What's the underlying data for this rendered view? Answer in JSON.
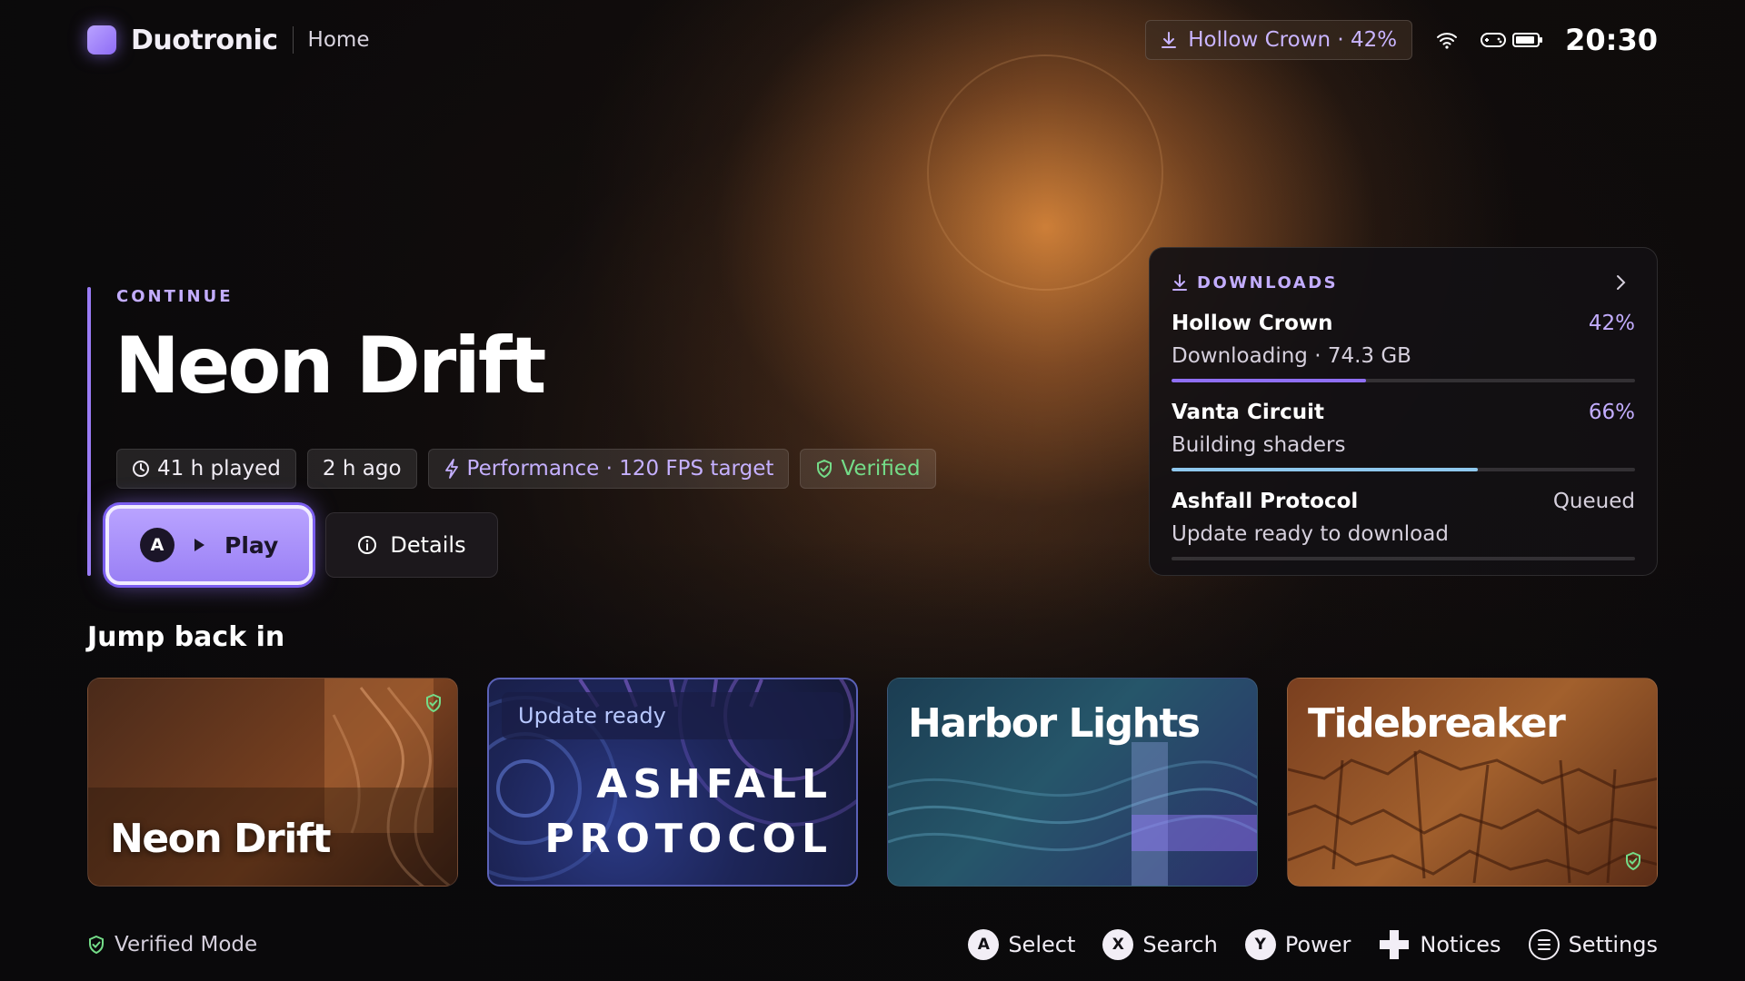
{
  "topbar": {
    "brand": "Duotronic",
    "crumb": "Home",
    "download_pill": "Hollow Crown · 42%",
    "clock": "20:30",
    "icons": [
      "download-icon",
      "wifi-icon",
      "gamepad-icon",
      "battery-icon"
    ]
  },
  "hero": {
    "eyebrow": "CONTINUE",
    "title": "Neon Drift",
    "chips": {
      "played": "41 h played",
      "ago": "2 h ago",
      "performance": "Performance · 120 FPS target",
      "verified": "Verified"
    },
    "play_key": "A",
    "play_label": "Play",
    "details_label": "Details"
  },
  "downloads": {
    "title": "DOWNLOADS",
    "items": [
      {
        "name": "Hollow Crown",
        "status": "42%",
        "detail": "Downloading · 74.3 GB",
        "progress": 0.42,
        "color": "#8f6ff5"
      },
      {
        "name": "Vanta Circuit",
        "status": "66%",
        "detail": "Building shaders",
        "progress": 0.66,
        "color": "#8fc8ee"
      },
      {
        "name": "Ashfall Protocol",
        "status": "Queued",
        "detail": "Update ready to download",
        "progress": 0.0,
        "color": "#8f6ff5"
      }
    ]
  },
  "jump": {
    "title": "Jump back in",
    "cards": [
      {
        "title": "Neon Drift"
      },
      {
        "badge": "Update ready",
        "title_line1": "ASHFALL",
        "title_line2": "PROTOCOL"
      },
      {
        "title": "Harbor Lights"
      },
      {
        "title": "Tidebreaker"
      }
    ]
  },
  "footer": {
    "verified_mode": "Verified Mode",
    "hints": [
      {
        "key": "A",
        "label": "Select"
      },
      {
        "key": "X",
        "label": "Search"
      },
      {
        "key": "Y",
        "label": "Power"
      },
      {
        "key": "dpad",
        "label": "Notices"
      },
      {
        "key": "menu",
        "label": "Settings"
      }
    ]
  },
  "colors": {
    "accent": "#9a7cf6",
    "verified": "#74dc88",
    "background": "#0b0a0c"
  }
}
